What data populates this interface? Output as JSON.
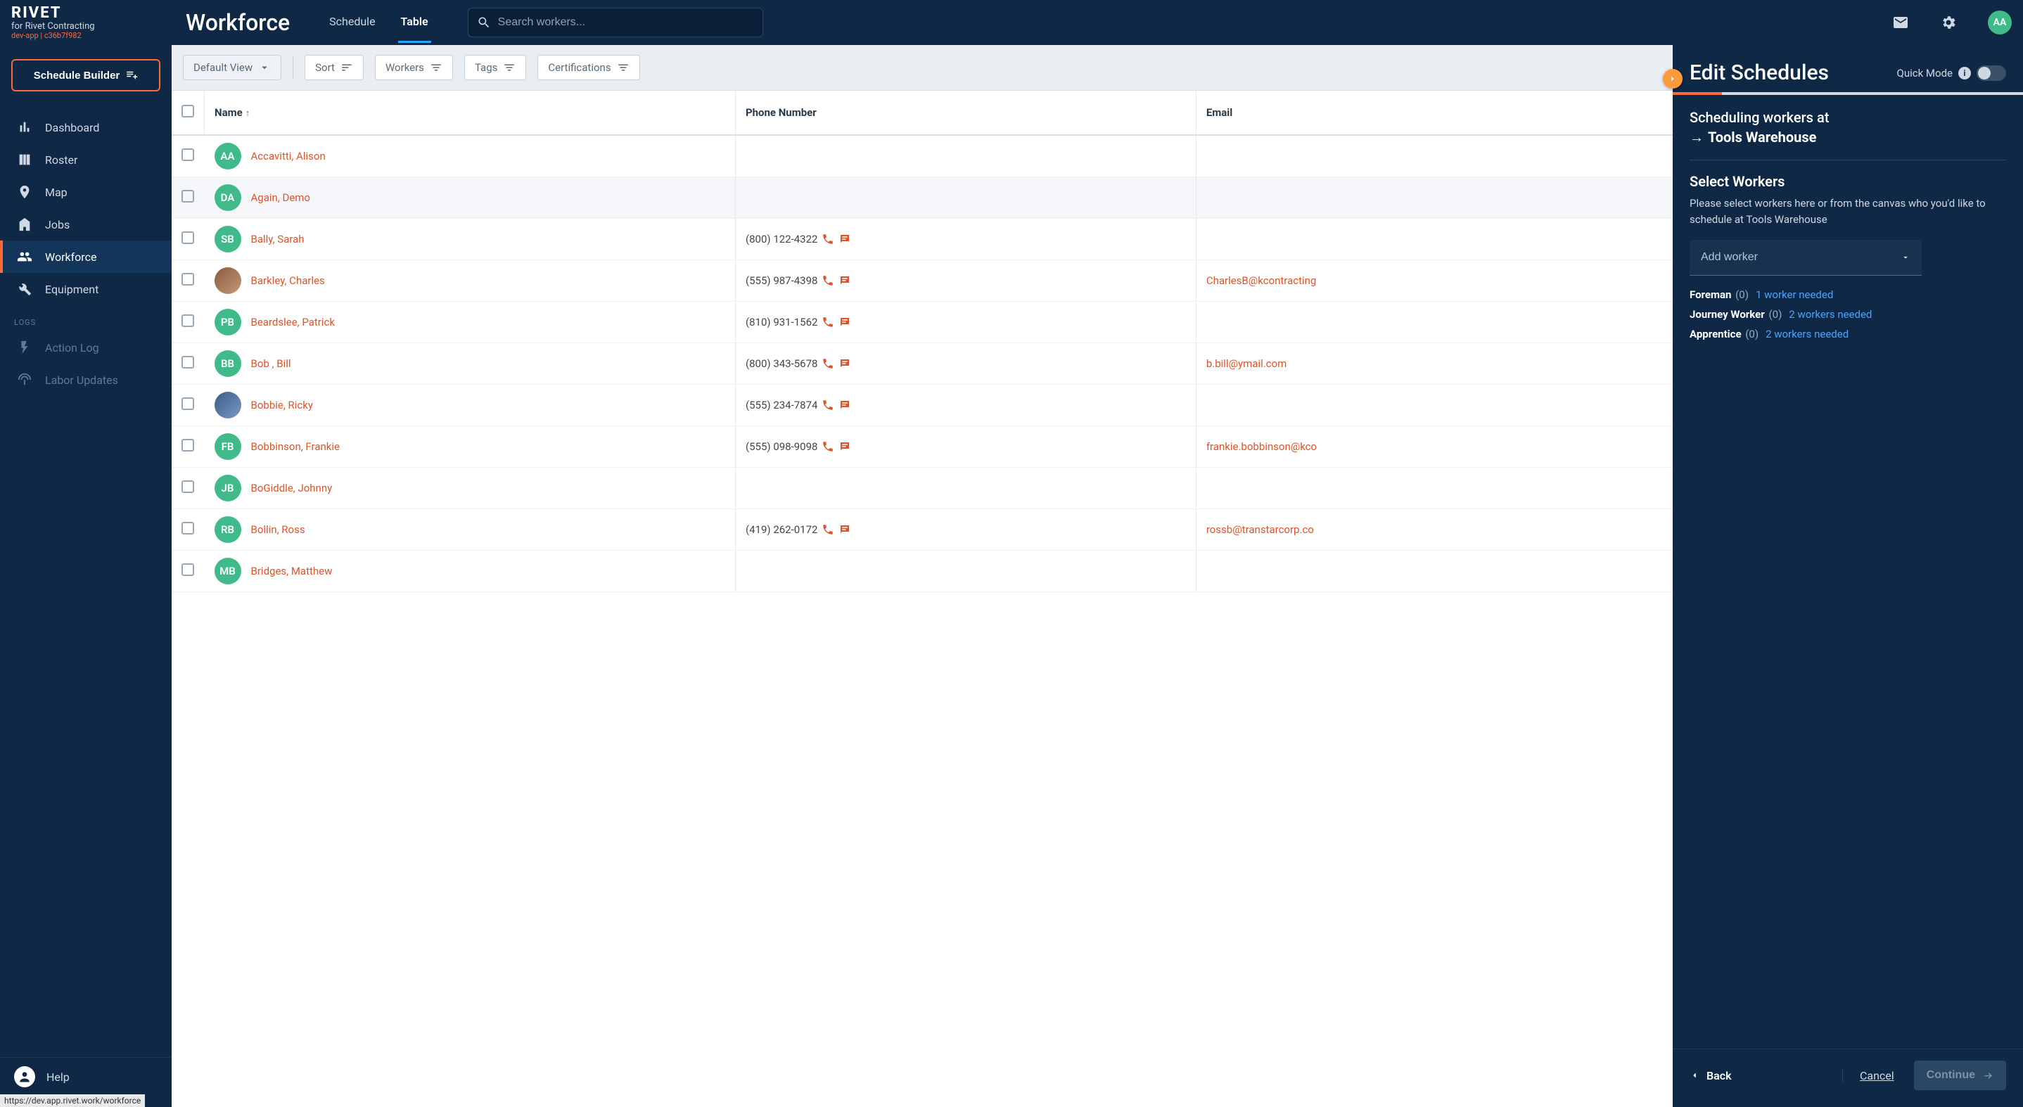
{
  "brand": {
    "logo": "RIVET",
    "subtitle": "for Rivet Contracting",
    "tag": "dev-app | c36b7f982"
  },
  "header": {
    "page_title": "Workforce",
    "tabs": [
      {
        "label": "Schedule",
        "active": false
      },
      {
        "label": "Table",
        "active": true
      }
    ],
    "search_placeholder": "Search workers...",
    "avatar_initials": "AA"
  },
  "sidebar": {
    "builder_button": "Schedule Builder",
    "items": [
      {
        "label": "Dashboard",
        "icon": "bar-chart-icon"
      },
      {
        "label": "Roster",
        "icon": "columns-icon"
      },
      {
        "label": "Map",
        "icon": "pin-icon"
      },
      {
        "label": "Jobs",
        "icon": "building-icon"
      },
      {
        "label": "Workforce",
        "icon": "people-icon",
        "active": true
      },
      {
        "label": "Equipment",
        "icon": "wrench-icon"
      }
    ],
    "logs_label": "LOGS",
    "logs": [
      {
        "label": "Action Log",
        "icon": "bolt-icon"
      },
      {
        "label": "Labor Updates",
        "icon": "broadcast-icon"
      }
    ],
    "help_label": "Help"
  },
  "filterbar": {
    "default_view": "Default View",
    "chips": [
      {
        "label": "Sort"
      },
      {
        "label": "Workers"
      },
      {
        "label": "Tags"
      },
      {
        "label": "Certifications"
      }
    ]
  },
  "table": {
    "columns": [
      "",
      "Name",
      "Phone Number",
      "Email"
    ],
    "sort_col": "Name",
    "rows": [
      {
        "initials": "AA",
        "name": "Accavitti, Alison",
        "phone": "",
        "email": ""
      },
      {
        "initials": "DA",
        "name": "Again, Demo",
        "phone": "",
        "email": "",
        "hover": true
      },
      {
        "initials": "SB",
        "name": "Bally, Sarah",
        "phone": "(800) 122-4322",
        "email": ""
      },
      {
        "initials": "",
        "avatar_img": true,
        "name": "Barkley, Charles",
        "phone": "(555) 987-4398",
        "email": "CharlesB@kcontracting"
      },
      {
        "initials": "PB",
        "name": "Beardslee, Patrick",
        "phone": "(810) 931-1562",
        "email": ""
      },
      {
        "initials": "BB",
        "name": "Bob , Bill",
        "phone": "(800) 343-5678",
        "email": "b.bill@ymail.com"
      },
      {
        "initials": "",
        "avatar_img2": true,
        "name": "Bobbie, Ricky",
        "phone": "(555) 234-7874",
        "email": ""
      },
      {
        "initials": "FB",
        "name": "Bobbinson, Frankie",
        "phone": "(555) 098-9098",
        "email": "frankie.bobbinson@kco"
      },
      {
        "initials": "JB",
        "name": "BoGiddle, Johnny",
        "phone": "",
        "email": ""
      },
      {
        "initials": "RB",
        "name": "Bollin, Ross",
        "phone": "(419) 262-0172",
        "email": "rossb@transtarcorp.co"
      },
      {
        "initials": "MB",
        "name": "Bridges, Matthew",
        "phone": "",
        "email": ""
      }
    ]
  },
  "panel": {
    "title": "Edit Schedules",
    "quick_mode_label": "Quick Mode",
    "heading_prefix": "Scheduling workers at",
    "destination": "Tools Warehouse",
    "section_title": "Select Workers",
    "section_desc": "Please select workers here or from the canvas who you'd like to schedule at Tools Warehouse",
    "add_worker_placeholder": "Add worker",
    "requirements": [
      {
        "role": "Foreman",
        "count": "(0)",
        "needed": "1 worker needed"
      },
      {
        "role": "Journey Worker",
        "count": "(0)",
        "needed": "2 workers needed"
      },
      {
        "role": "Apprentice",
        "count": "(0)",
        "needed": "2 workers needed"
      }
    ],
    "footer": {
      "back": "Back",
      "cancel": "Cancel",
      "continue": "Continue"
    }
  },
  "status_url": "https://dev.app.rivet.work/workforce"
}
